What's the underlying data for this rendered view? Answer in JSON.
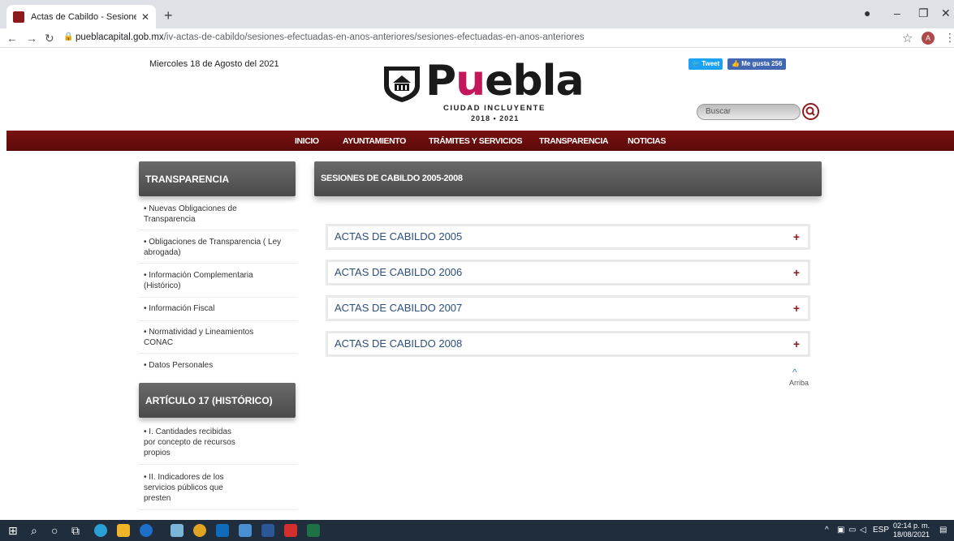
{
  "browser": {
    "tab_title": "Actas de Cabildo - Sesiones de C",
    "tab_close": "✕",
    "new_tab": "+",
    "url_domain": "pueblacapital.gob.mx",
    "url_path": "/iv-actas-de-cabildo/sesiones-efectuadas-en-anos-anteriores/sesiones-efectuadas-en-anos-anteriores",
    "avatar_letter": "A"
  },
  "header": {
    "date": "Miercoles 18 de Agosto del 2021",
    "logo_prefix": "P",
    "logo_u": "u",
    "logo_suffix": "ebla",
    "logo_sub": "CIUDAD INCLUYENTE",
    "logo_years": "2018 • 2021",
    "tweet": "Tweet",
    "like": "Me gusta 256",
    "search_placeholder": "Buscar"
  },
  "nav": [
    "INICIO",
    "AYUNTAMIENTO",
    "TRÁMITES Y SERVICIOS",
    "TRANSPARENCIA",
    "NOTICIAS"
  ],
  "sidebar": {
    "section1": "TRANSPARENCIA",
    "items1": [
      [
        "• Nuevas Obligaciones de",
        "Transparencia"
      ],
      [
        "• Obligaciones de Transparencia ( Ley",
        "abrogada)"
      ],
      [
        "• Información Complementaria",
        "(Histórico)"
      ],
      [
        "• Información Fiscal"
      ],
      [
        "• Normatividad y Lineamientos",
        "CONAC"
      ],
      [
        "• Datos Personales"
      ]
    ],
    "section2": "ARTÍCULO 17 (HISTÓRICO)",
    "items2": [
      [
        "• I. Cantidades recibidas",
        "por concepto de recursos",
        "propios"
      ],
      [
        "• II. Indicadores de los",
        "servicios públicos que",
        "presten"
      ]
    ]
  },
  "main": {
    "heading": "SESIONES DE CABILDO 2005-2008",
    "accordions": [
      "ACTAS DE CABILDO 2005",
      "ACTAS DE CABILDO 2006",
      "ACTAS DE CABILDO 2007",
      "ACTAS DE CABILDO 2008"
    ],
    "expand_symbol": "+",
    "back_to_top": "Arriba"
  },
  "taskbar": {
    "lang": "ESP",
    "time": "02:14 p. m.",
    "date": "18/08/2021"
  },
  "colors": {
    "brand": "#7a1111",
    "accordion_text": "#2c4f7c"
  }
}
